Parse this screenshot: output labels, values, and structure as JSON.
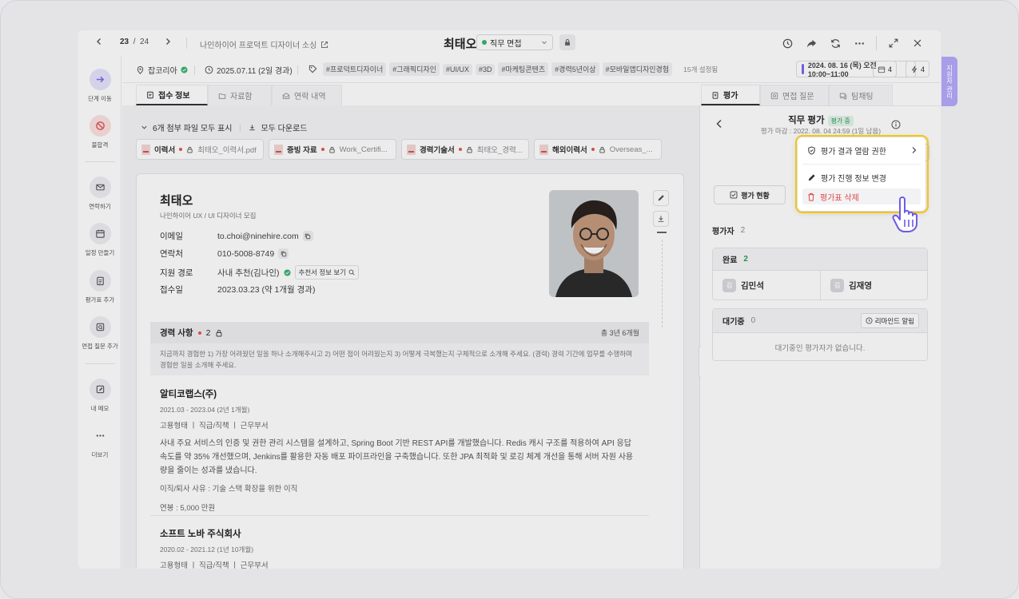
{
  "titlebar": {
    "page_current": "23",
    "page_sep": "/",
    "page_total": "24",
    "job_posting": "나인하이어 프로덕트 디자이너 소싱",
    "candidate": "최태오",
    "stage": "직무 면접"
  },
  "sidebar": {
    "items": [
      {
        "label": "단계 이동",
        "icon": "arrow-right-icon"
      },
      {
        "label": "불합격",
        "icon": "block-icon"
      },
      {
        "label": "연락하기",
        "icon": "mail-icon"
      },
      {
        "label": "일정 만들기",
        "icon": "calendar-icon"
      },
      {
        "label": "평가표 추가",
        "icon": "clipboard-icon"
      },
      {
        "label": "면접 질문 추가",
        "icon": "question-icon"
      },
      {
        "label": "내 메모",
        "icon": "edit-icon"
      },
      {
        "label": "더보기",
        "icon": "more-icon"
      }
    ]
  },
  "infobar": {
    "source": "잡코리아",
    "date": "2025.07.11 (2일 경과)",
    "tags": [
      "#프로덕트디자이너",
      "#그래픽디자인",
      "#UI/UX",
      "#3D",
      "#마케팅콘텐츠",
      "#경력5년이상",
      "#모바일앱디자인경험"
    ],
    "tag_count": "15개 설정됨",
    "schedule": "2024. 08. 16 (목) 오전 10:00~11:00",
    "calendar_count": "4",
    "flash_count": "4"
  },
  "left_tabs": [
    "접수 정보",
    "자료함",
    "연락 내역"
  ],
  "files": {
    "toggle": "6개 첨부 파일 모두 표시",
    "download": "모두 다운로드",
    "chips": [
      {
        "label": "이력서",
        "file": "최태오_이력서.pdf"
      },
      {
        "label": "증빙 자료",
        "file": "Work_Certifi..."
      },
      {
        "label": "경력기술서",
        "file": "최태오_경력..."
      },
      {
        "label": "해외이력서",
        "file": "Overseas_..."
      }
    ]
  },
  "profile": {
    "name": "최태오",
    "subtitle": "나인하이어 UX / UI 디자이너 모집",
    "fields": [
      {
        "key": "이메일",
        "value": "to.choi@ninehire.com"
      },
      {
        "key": "연락처",
        "value": "010-5008-8749"
      },
      {
        "key": "지원 경로",
        "value": "사내 추천(김나인)"
      },
      {
        "key": "접수일",
        "value": "2023.03.23 (약 1개월 경과)"
      }
    ],
    "referral_link": "추천서 정보 보기"
  },
  "career": {
    "title": "경력 사항",
    "count": "2",
    "total": "총 3년 6개월",
    "desc": "지금까지 경험한 1) 가장 어려웠던 일을 하나 소개해주시고 2) 어떤 점이 어려웠는지 3) 어떻게 극복했는지 구체적으로 소개해 주세요. (경력) 경력 기간에 업무를 수행하며 경험한 일을 소개해 주세요.",
    "jobs": [
      {
        "company": "알티코랩스(주)",
        "period": "2021.03 - 2023.04 (2년 1개월)",
        "meta": "고용형태 ㅣ 직급/직책 ㅣ 근무부서",
        "body": "사내 주요 서비스의 인증 및 권한 관리 시스템을 설계하고, Spring Boot 기반 REST API를 개발했습니다. Redis 캐시 구조를 적용하여 API 응답 속도를 약 35% 개선했으며, Jenkins를 활용한 자동 배포 파이프라인을 구축했습니다. 또한 JPA 최적화 및 로깅 체계 개선을 통해 서버 자원 사용량을 줄이는 성과를 냈습니다.",
        "reason": "이직/퇴사 사유 : 기술 스택 확장을 위한 이직",
        "salary": "연봉 : 5,000 만원"
      },
      {
        "company": "소프트 노바 주식회사",
        "period": "2020.02 - 2021.12 (1년 10개월)",
        "meta": "고용형태 ㅣ 직급/직책 ㅣ 근무부서"
      }
    ]
  },
  "right": {
    "tabs": [
      "평가",
      "면접 질문",
      "팀채팅"
    ],
    "eval_title": "직무 평가",
    "status": "평가 중",
    "due": "평가 마감 : 2022. 08. 04 24:59 (1일 남음)",
    "status_button": "평가 현황",
    "evaluators_label": "평가자",
    "evaluators_count": "2",
    "done_label": "완료",
    "done_count": "2",
    "done_people": [
      {
        "initial": "김",
        "name": "김민석"
      },
      {
        "initial": "김",
        "name": "김재영"
      }
    ],
    "waiting_label": "대기중",
    "waiting_count": "0",
    "remind": "리마인드 알림",
    "empty": "대기중인 평가자가 없습니다."
  },
  "menu": {
    "items": [
      "평가 결과 열람 권한",
      "평가 진행 정보 변경",
      "평가표 삭제"
    ]
  },
  "side_pill": "지원자 관리",
  "colors": {
    "accent": "#7b68ee",
    "success": "#3cb371",
    "danger": "#e04848",
    "highlight": "#f5c518"
  }
}
